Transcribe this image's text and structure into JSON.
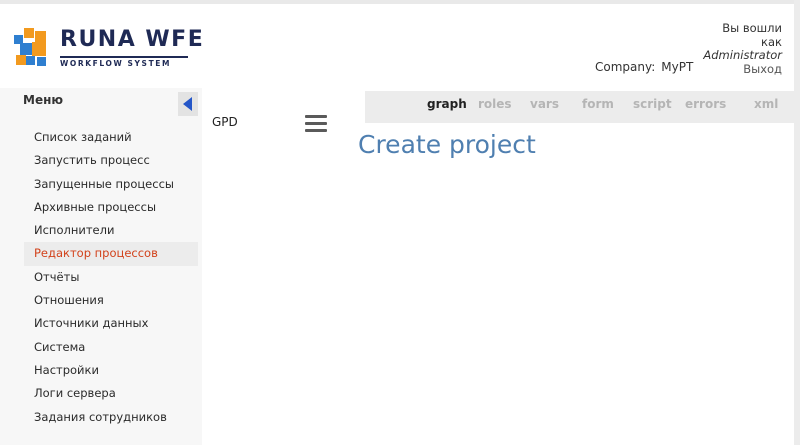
{
  "app": {
    "logo_title": "RUNA WFE",
    "logo_subtitle": "WORKFLOW SYSTEM"
  },
  "header": {
    "company_label": "Company:",
    "company_value": "MyPT",
    "login_prefix": "Вы вошли",
    "login_as": "как",
    "user": "Administrator",
    "logout": "Выход"
  },
  "sidebar": {
    "title": "Меню",
    "items": [
      {
        "label": "Список заданий"
      },
      {
        "label": "Запустить процесс"
      },
      {
        "label": "Запущенные процессы"
      },
      {
        "label": "Архивные процессы"
      },
      {
        "label": "Исполнители"
      },
      {
        "label": "Редактор процессов"
      },
      {
        "label": "Отчёты"
      },
      {
        "label": "Отношения"
      },
      {
        "label": "Источники данных"
      },
      {
        "label": "Система"
      },
      {
        "label": "Настройки"
      },
      {
        "label": "Логи сервера"
      },
      {
        "label": "Задания сотрудников"
      }
    ],
    "active_item": "Редактор процессов"
  },
  "main": {
    "gpd_label": "GPD",
    "page_title": "Create project",
    "tabs": [
      {
        "label": "graph"
      },
      {
        "label": "roles"
      },
      {
        "label": "vars"
      },
      {
        "label": "form"
      },
      {
        "label": "script"
      },
      {
        "label": "errors"
      },
      {
        "label": "xml"
      }
    ],
    "active_tab": "graph"
  },
  "colors": {
    "accent_active_menu": "#d2421b",
    "title_blue": "#4f7fb0",
    "collapse_arrow": "#2456c8",
    "logo_navy": "#1f2a55",
    "logo_orange": "#f29a1f",
    "logo_blue": "#2f7fd0"
  },
  "icons": {
    "collapse": "chevron-left-icon",
    "menu": "hamburger-icon",
    "logo": "runa-logo-icon"
  }
}
